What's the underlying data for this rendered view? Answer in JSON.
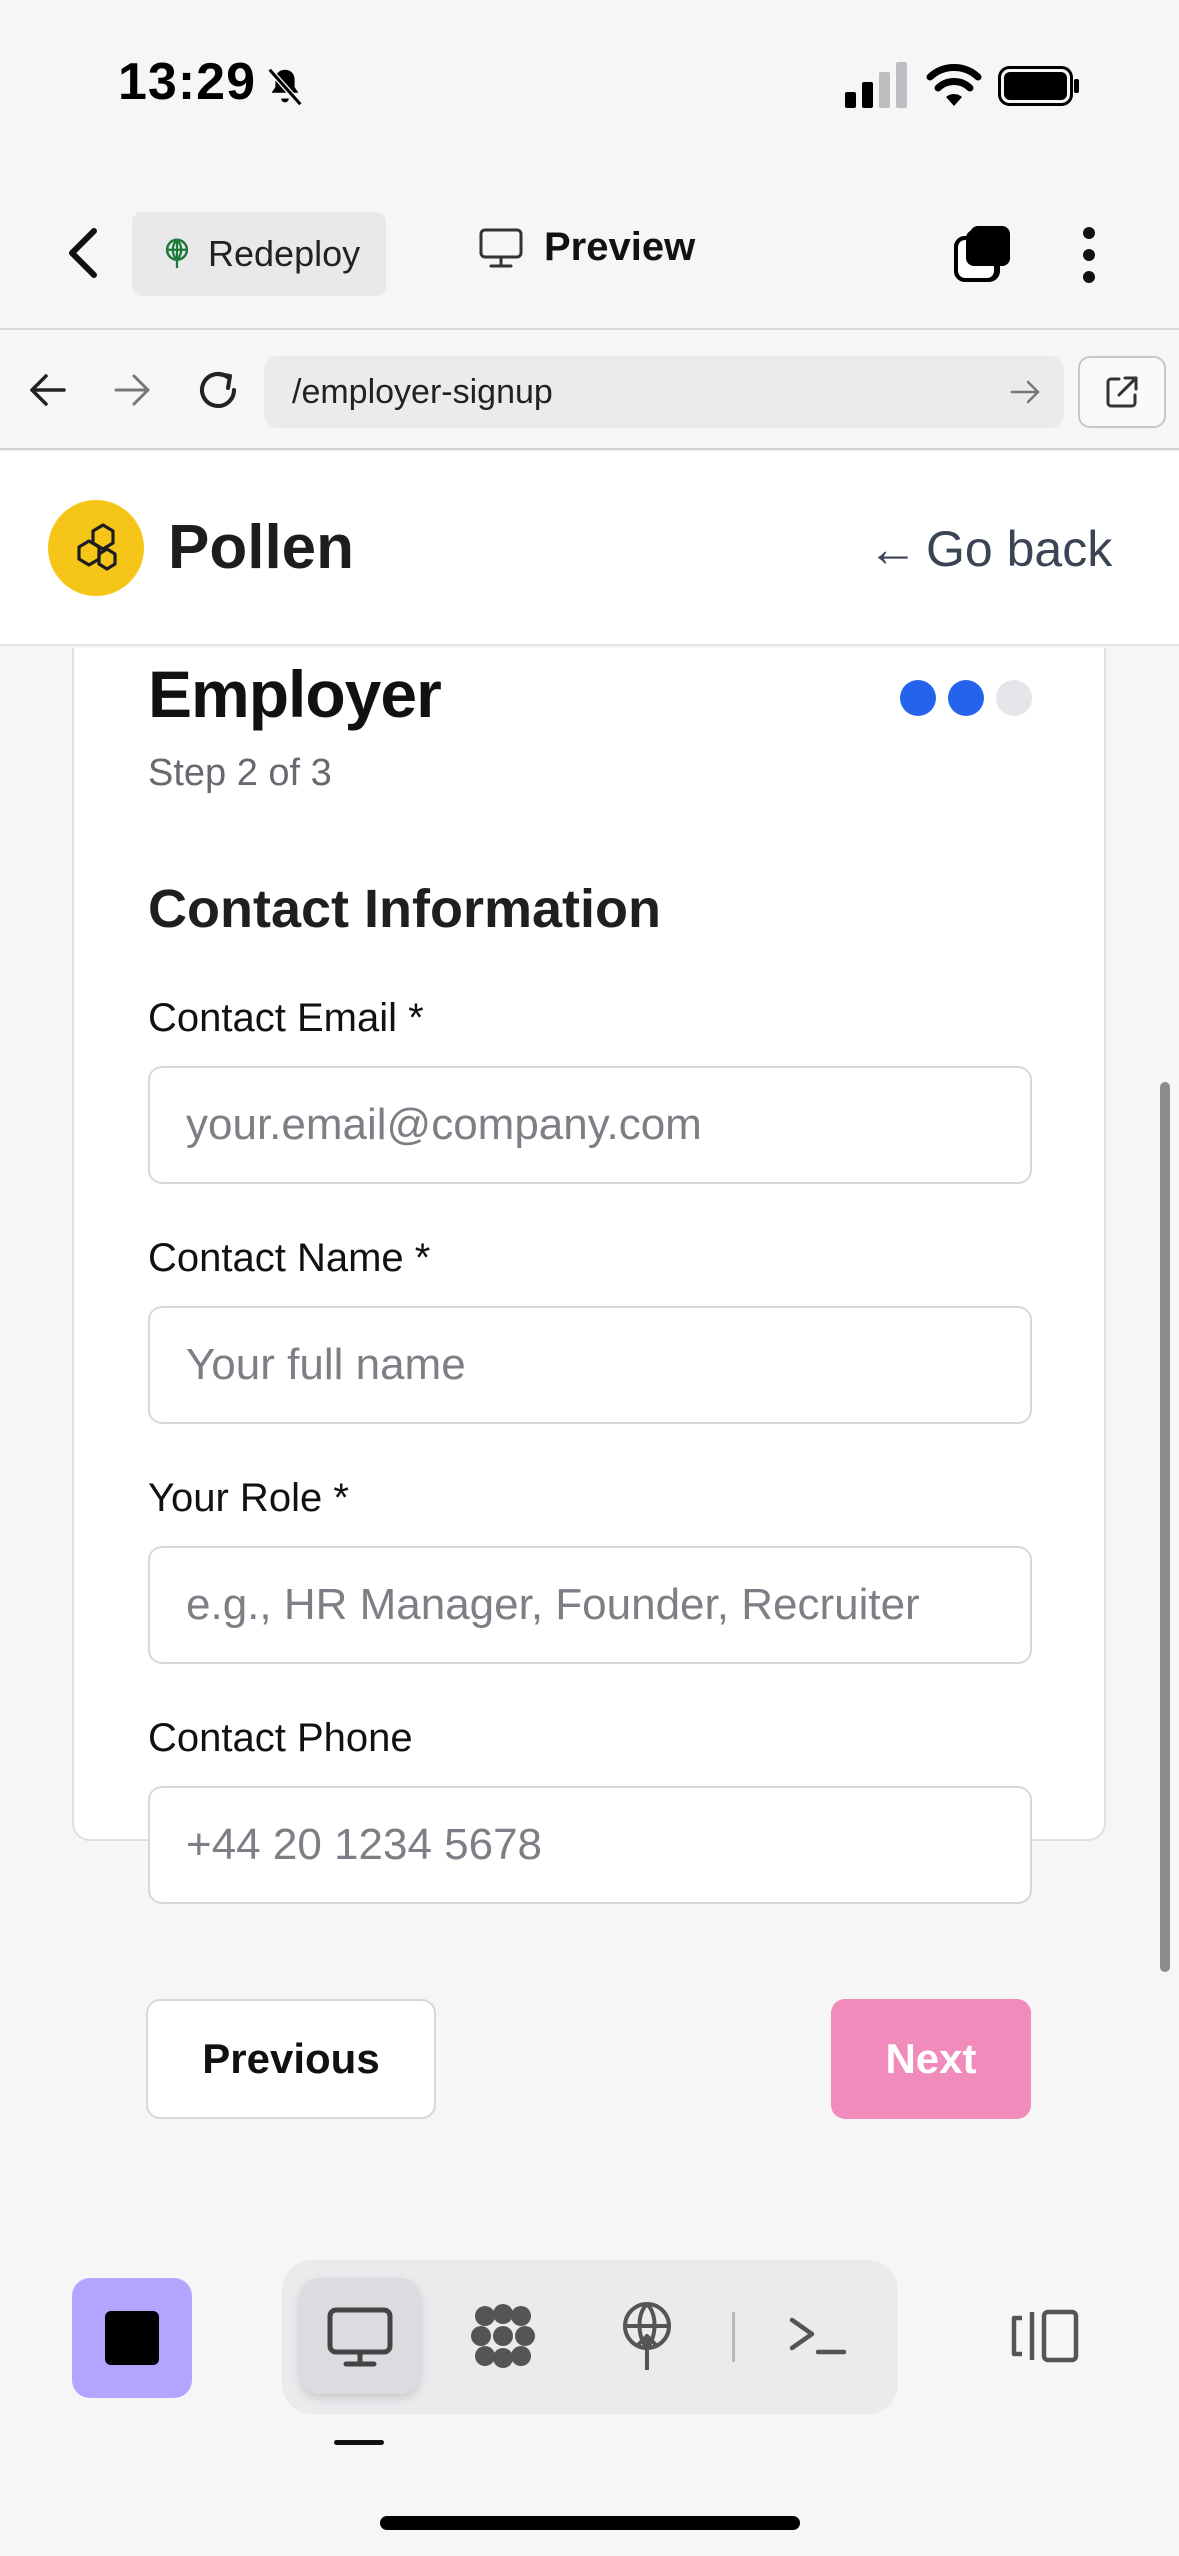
{
  "status": {
    "time": "13:29"
  },
  "toolbar": {
    "redeploy_label": "Redeploy",
    "preview_label": "Preview"
  },
  "browser": {
    "url": "/employer-signup"
  },
  "app": {
    "brand": "Pollen",
    "go_back": "Go back",
    "go_back_arrow": "←"
  },
  "form": {
    "title": "Employer",
    "step": "Step 2 of 3",
    "progress": {
      "current_step": 2,
      "total_steps": 3
    },
    "section_title": "Contact Information",
    "fields": [
      {
        "label": "Contact Email *",
        "placeholder": "your.email@company.com",
        "value": ""
      },
      {
        "label": "Contact Name *",
        "placeholder": "Your full name",
        "value": ""
      },
      {
        "label": "Your Role *",
        "placeholder": "e.g., HR Manager, Founder, Recruiter",
        "value": ""
      },
      {
        "label": "Contact Phone",
        "placeholder": "+44 20 1234 5678",
        "value": ""
      }
    ],
    "previous_label": "Previous",
    "next_label": "Next"
  },
  "colors": {
    "accent_blue": "#2563eb",
    "dot_inactive": "#e5e5ea",
    "next_button": "#f08bbb",
    "logo_yellow": "#f5c518",
    "stop_button": "#b3a4ff"
  },
  "icons": {
    "bottom_tools": [
      "monitor-icon",
      "agent-icon",
      "deploy-icon",
      "terminal-icon"
    ],
    "side": "split-view-icon"
  }
}
